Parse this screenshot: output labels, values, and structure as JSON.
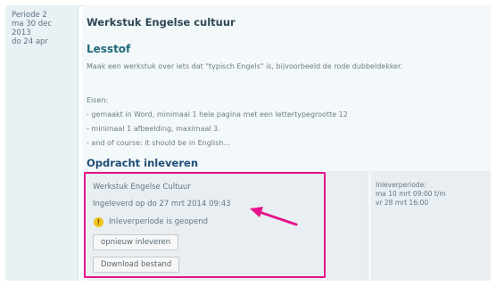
{
  "period": {
    "lines": [
      "Periode 2",
      "ma 30 dec",
      "2013",
      "do 24 apr"
    ]
  },
  "assignment": {
    "title": "Werkstuk Engelse cultuur",
    "lesstof_heading": "Lesstof",
    "description": "Maak een werkstuk over iets dat \"typisch Engels\" is, bijvoorbeeld de rode dubbeldekker.",
    "requirements_heading": "Eisen:",
    "requirements": [
      "- gemaakt in Word, minimaal 1 hele pagina met een lettertypegrootte 12",
      "- minimaal 1 afbeelding, maximaal 3.",
      "- and of course: it should be in English..."
    ]
  },
  "submission": {
    "section_heading": "Opdracht inleveren",
    "name": "Werkstuk Engelse Cultuur",
    "submitted_text": "Ingeleverd op do 27 mrt 2014 09:43",
    "status_icon": "warning-icon",
    "status_text": "Inleverperiode is geopend",
    "resubmit_label": "opnieuw inleveren",
    "download_label": "Download bestand"
  },
  "deadline": {
    "label": "Inleverperiode:",
    "from": "ma 10 mrt 09:00 t/m",
    "to": "vr 28 mrt 16:00"
  },
  "colors": {
    "highlight": "#e6138a",
    "heading": "#1f6a78"
  }
}
